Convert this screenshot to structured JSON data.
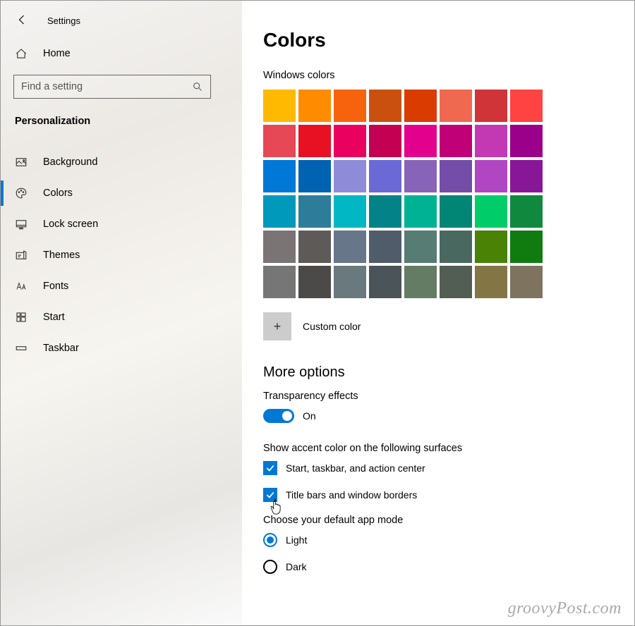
{
  "window_title": "Settings",
  "sidebar": {
    "home_label": "Home",
    "search_placeholder": "Find a setting",
    "category_label": "Personalization",
    "items": [
      {
        "id": "background",
        "label": "Background"
      },
      {
        "id": "colors",
        "label": "Colors"
      },
      {
        "id": "lock-screen",
        "label": "Lock screen"
      },
      {
        "id": "themes",
        "label": "Themes"
      },
      {
        "id": "fonts",
        "label": "Fonts"
      },
      {
        "id": "start",
        "label": "Start"
      },
      {
        "id": "taskbar",
        "label": "Taskbar"
      }
    ],
    "active_id": "colors"
  },
  "main": {
    "page_title": "Colors",
    "palette_label": "Windows colors",
    "colors": [
      "#ffb900",
      "#ff8c00",
      "#f7630c",
      "#ca5010",
      "#da3b01",
      "#ef6950",
      "#d13438",
      "#ff4343",
      "#e74856",
      "#e81123",
      "#ea005e",
      "#c30052",
      "#e3008c",
      "#bf0077",
      "#c239b3",
      "#9a0089",
      "#0078d7",
      "#0063b1",
      "#8e8cd8",
      "#6b69d6",
      "#8764b8",
      "#744da9",
      "#b146c2",
      "#881798",
      "#0099bc",
      "#2d7d9a",
      "#00b7c3",
      "#038387",
      "#00b294",
      "#018574",
      "#00cc6a",
      "#10893e",
      "#7a7574",
      "#5d5a58",
      "#68768a",
      "#515c6b",
      "#567c73",
      "#486860",
      "#498205",
      "#107c10",
      "#767676",
      "#4c4a48",
      "#69797e",
      "#4a5459",
      "#647c64",
      "#525e54",
      "#847545",
      "#7e735f"
    ],
    "custom_color_label": "Custom color",
    "more_options_heading": "More options",
    "transparency_label": "Transparency effects",
    "transparency_state": "On",
    "accent_surfaces_label": "Show accent color on the following surfaces",
    "accent_opt_start": "Start, taskbar, and action center",
    "accent_opt_title": "Title bars and window borders",
    "default_mode_label": "Choose your default app mode",
    "mode_light": "Light",
    "mode_dark": "Dark"
  },
  "watermark": "groovyPost.com"
}
